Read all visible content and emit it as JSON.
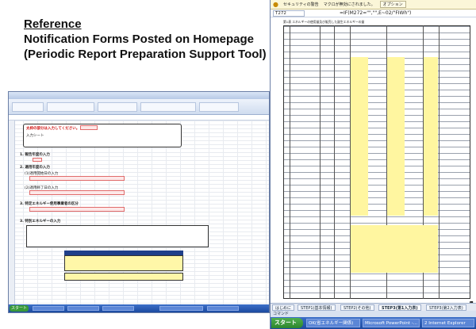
{
  "title": {
    "reference": "Reference",
    "line2": "Notification Forms Posted on Homepage",
    "line3": "(Periodic Report Preparation Support Tool)"
  },
  "small_window": {
    "header_text": "入力シート",
    "notice_red": "太枠の部分は入力してください。",
    "step1": "1. 報告年度の入力",
    "step2": "2. 適用年度の入力",
    "step2a": "(1)適用開始日の入力",
    "step2b": "(2)適用終了日の入力",
    "step3": "3. 特定エネルギー使用事業者の区分",
    "step4": "3. 特別エネルギーの入力",
    "taskbar_start": "スタート"
  },
  "big_window": {
    "security_label": "セキュリティの警告",
    "security_msg": "マクロが無効にされました。",
    "options_button": "オプション",
    "cell_ref": "T272",
    "formula": "=IF(M272=\"\",\"\",E~02/\"FIWh\")",
    "sheet_title": "第1表 エネルギーの使用量及び販売した副生エネルギーの量",
    "tabs": [
      "はじめに",
      "STEP1(基本情報)",
      "STEP2(その他)",
      "STEP3(第1入力表)",
      "STEP3(第2入力表)"
    ],
    "status_bar": "コマンド",
    "page_number": "1",
    "taskbar": {
      "start": "スタート",
      "items": [
        "OK(省エネルギー関係)",
        "Microsoft PowerPoint -...",
        "2 Internet Explorer"
      ]
    }
  }
}
